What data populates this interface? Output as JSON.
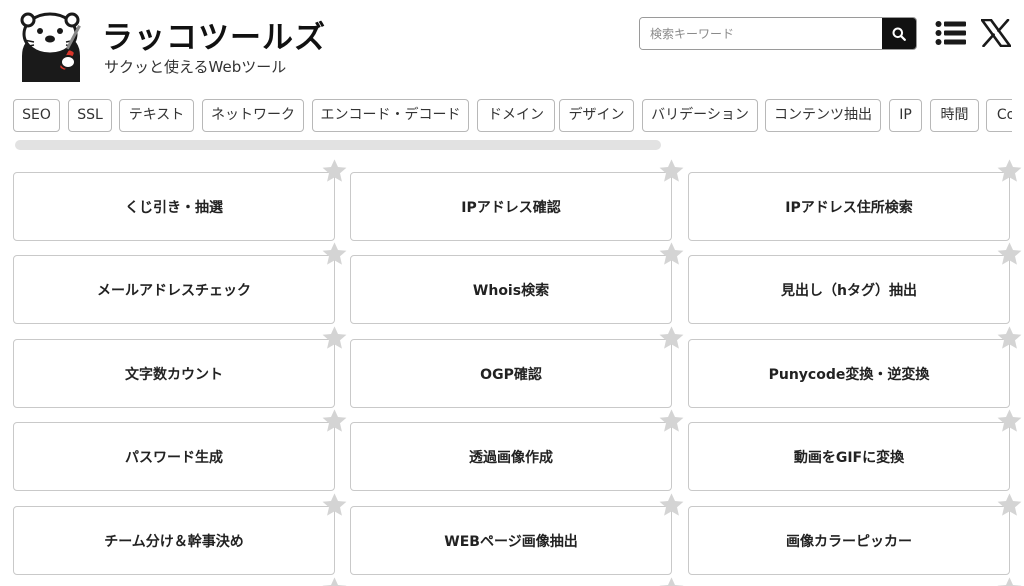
{
  "header": {
    "title": "ラッコツールズ",
    "subtitle": "サクッと使えるWebツール"
  },
  "search": {
    "placeholder": "検索キーワード",
    "value": ""
  },
  "tags": [
    "SEO",
    "SSL",
    "テキスト",
    "ネットワーク",
    "エンコード・デコード",
    "ドメイン",
    "デザイン",
    "バリデーション",
    "コンテンツ抽出",
    "IP",
    "時間",
    "Co"
  ],
  "tools": [
    [
      "くじ引き・抽選",
      "IPアドレス確認",
      "IPアドレス住所検索"
    ],
    [
      "メールアドレスチェック",
      "Whois検索",
      "見出し（hタグ）抽出"
    ],
    [
      "文字数カウント",
      "OGP確認",
      "Punycode変換・逆変換"
    ],
    [
      "パスワード生成",
      "透過画像作成",
      "動画をGIFに変換"
    ],
    [
      "チーム分け＆幹事決め",
      "WEBページ画像抽出",
      "画像カラーピッカー"
    ]
  ],
  "icons": {
    "search": "search-icon",
    "menu": "list-menu-icon",
    "x": "x-logo-icon",
    "favorite": "star-icon",
    "mascot": "otter-mascot-logo"
  },
  "colors": {
    "star": "#d4d4d4",
    "card_border": "#c9c9c9",
    "button_dark": "#111111"
  }
}
